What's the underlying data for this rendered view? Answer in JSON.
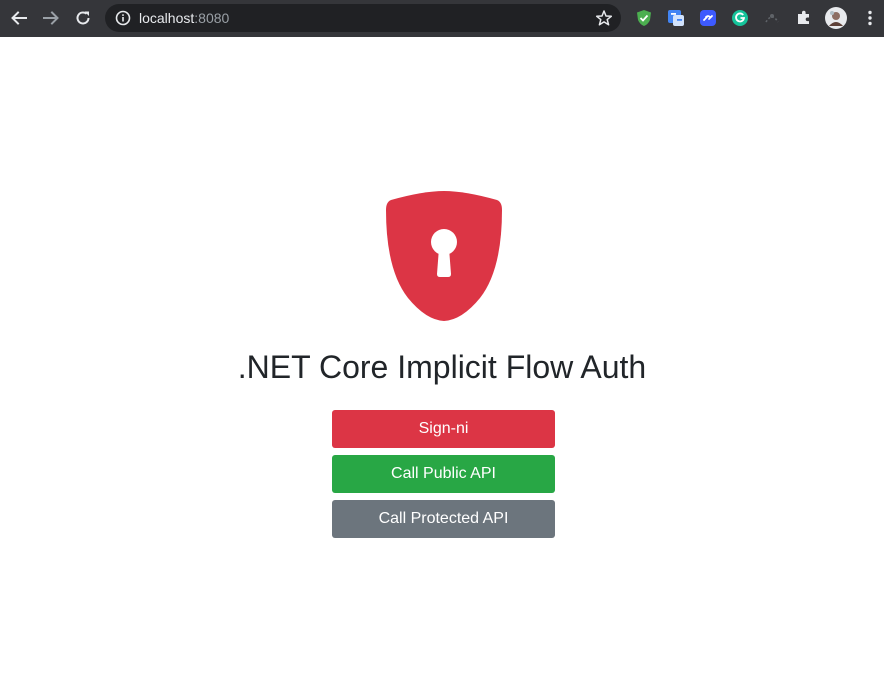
{
  "browser": {
    "url_host": "localhost",
    "url_port": ":8080",
    "icons": {
      "back": "back-arrow-icon",
      "forward": "forward-arrow-icon",
      "reload": "reload-icon",
      "site_info": "info-icon",
      "bookmark": "star-icon",
      "extensions": "puzzle-icon",
      "menu": "kebab-menu-icon"
    }
  },
  "page": {
    "logo_icon": "shield-keyhole-icon",
    "title": ".NET Core Implicit Flow Auth",
    "buttons": {
      "sign_in": "Sign-ni",
      "public_api": "Call Public API",
      "protected_api": "Call Protected API"
    }
  },
  "colors": {
    "danger": "#dc3545",
    "success": "#28a745",
    "secondary": "#6c757d",
    "toolbar": "#35363a",
    "omnibox": "#202124"
  }
}
